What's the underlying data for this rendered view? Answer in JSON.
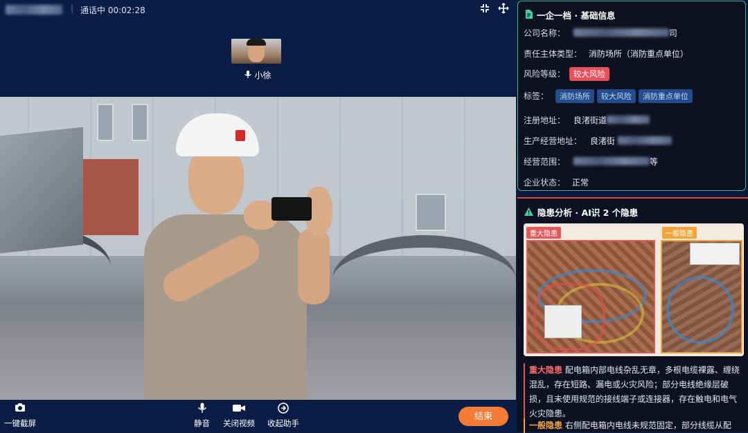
{
  "topbar": {
    "call_status": "通话中 00:02:28",
    "separator": "|"
  },
  "pip": {
    "name": "小徐"
  },
  "controls": {
    "screenshot": "一键截屏",
    "mute": "静音",
    "video_off": "关闭视频",
    "collapse_assistant": "收起助手",
    "end": "结束"
  },
  "info_panel": {
    "title": "一企一档 · 基础信息",
    "company_label": "公司名称：",
    "company_value_suffix": "司",
    "entity_type_label": "责任主体类型：",
    "entity_type_value": "消防场所（消防重点单位）",
    "risk_label": "风险等级：",
    "risk_value": "较大风险",
    "tags_label": "标签：",
    "tags": [
      "消防场所",
      "较大风险",
      "消防重点单位"
    ],
    "reg_addr_label": "注册地址：",
    "reg_addr_value": "良渚街道",
    "biz_addr_label": "生产经营地址：",
    "biz_addr_value": "良渚街",
    "scope_label": "经营范围：",
    "scope_suffix": "等",
    "status_label": "企业状态：",
    "status_value": "正常"
  },
  "hazard_panel": {
    "title": "隐患分析 · AI识 2 个隐患",
    "img_tag_major": "重大隐患",
    "img_tag_general": "一般隐患",
    "major_title": "重大隐患",
    "major_text": "配电箱内部电线杂乱无章，多根电缆裸露、缠绕混乱，存在短路、漏电或火灾风险；部分电线绝缘层破损，且未使用规范的接线端子或连接器，存在触电和电气火灾隐患。",
    "general_title": "一般隐患",
    "general_text": "右侧配电箱内电线未规范固定，部分线缆从配"
  },
  "colors": {
    "accent_green": "#3fb594",
    "danger_red": "#e8505a",
    "warning_orange": "#f1a43a",
    "end_button": "#f27b35",
    "tag_blue": "#234c8c"
  },
  "icons": [
    "shrink-icon",
    "move-icon",
    "mic-icon",
    "camera-icon",
    "video-icon",
    "assistant-icon",
    "document-icon",
    "warning-icon"
  ]
}
